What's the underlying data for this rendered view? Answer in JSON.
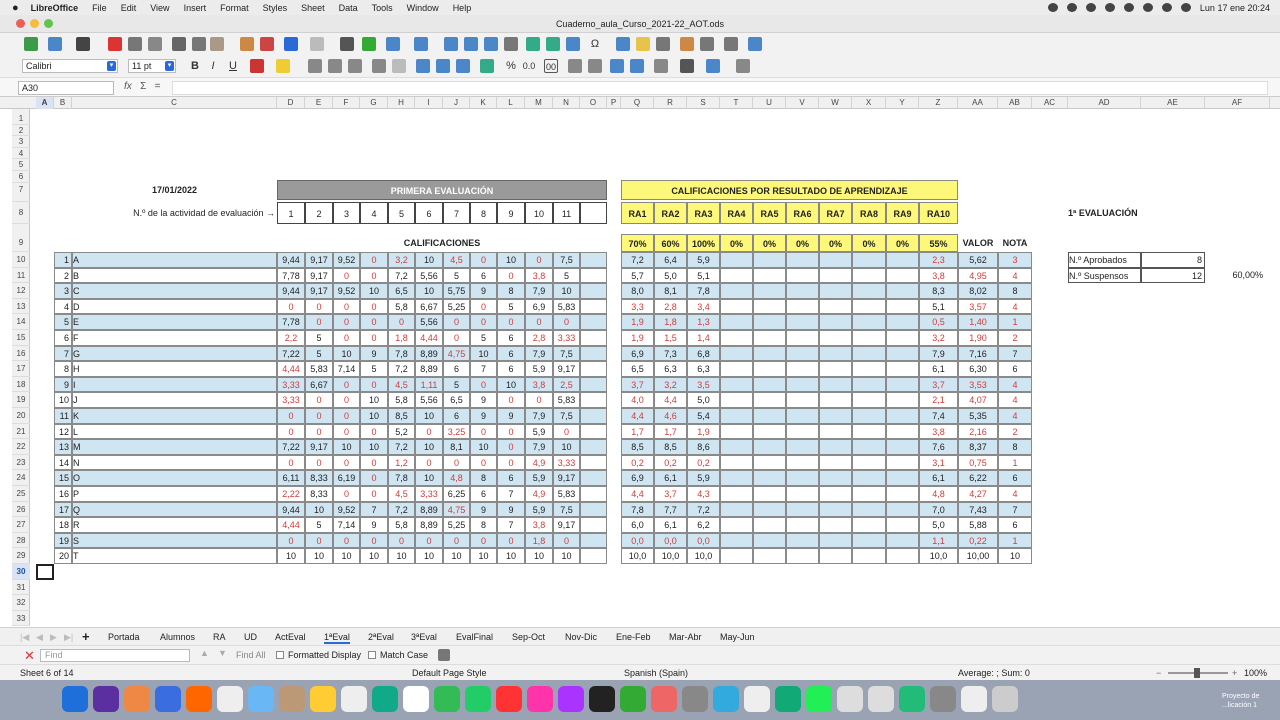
{
  "menubar": {
    "apple": "",
    "app": "LibreOffice",
    "items": [
      "File",
      "Edit",
      "View",
      "Insert",
      "Format",
      "Styles",
      "Sheet",
      "Data",
      "Tools",
      "Window",
      "Help"
    ],
    "clock": "Lun 17 ene  20:24"
  },
  "window": {
    "title": "Cuaderno_aula_Curso_2021-22_AOT.ods"
  },
  "toolbar": {
    "font_name": "Calibri",
    "font_size": "11 pt",
    "bold": "B",
    "italic": "I",
    "underline": "U",
    "percent": "%",
    "decimal": "0.0",
    "dec_places": "00"
  },
  "formula": {
    "cell_ref": "A30",
    "fx": "fx",
    "sigma": "Σ",
    "equals": "=",
    "content": ""
  },
  "columns": [
    "A",
    "B",
    "C",
    "D",
    "E",
    "F",
    "G",
    "H",
    "I",
    "J",
    "K",
    "L",
    "M",
    "N",
    "O",
    "P",
    "Q",
    "R",
    "S",
    "T",
    "U",
    "V",
    "W",
    "X",
    "Y",
    "Z",
    "AA",
    "AB",
    "AC",
    "AD",
    "AE",
    "AF"
  ],
  "rows": [
    "1",
    "2",
    "3",
    "4",
    "5",
    "6",
    "7",
    "8",
    "9",
    "10",
    "11",
    "12",
    "13",
    "14",
    "15",
    "16",
    "17",
    "18",
    "19",
    "20",
    "21",
    "22",
    "23",
    "24",
    "25",
    "26",
    "27",
    "28",
    "29",
    "30",
    "31",
    "32",
    "33"
  ],
  "sheet": {
    "date": "17/01/2022",
    "primera": "PRIMERA EVALUACIÓN",
    "activity_label": "N.º de la actividad de evaluación →",
    "activities": [
      "1",
      "2",
      "3",
      "4",
      "5",
      "6",
      "7",
      "8",
      "9",
      "10",
      "11"
    ],
    "calificaciones": "CALIFICACIONES",
    "ra_title": "CALIFICACIONES POR RESULTADO DE APRENDIZAJE",
    "ra_labels": [
      "RA1",
      "RA2",
      "RA3",
      "RA4",
      "RA5",
      "RA6",
      "RA7",
      "RA8",
      "RA9",
      "RA10"
    ],
    "ra_weights": [
      "70%",
      "60%",
      "100%",
      "0%",
      "0%",
      "0%",
      "0%",
      "0%",
      "0%",
      "55%"
    ],
    "valor": "VALOR",
    "nota": "NOTA",
    "eval_title": "1ª EVALUACIÓN",
    "aprobados_label": "N.º Aprobados",
    "aprobados": "8",
    "suspensos_label": "N.º Suspensos",
    "suspensos": "12",
    "suspensos_pct": "60,00%",
    "students": [
      {
        "n": "1",
        "name": "A",
        "acts": [
          "9,44",
          "9,17",
          "9,52",
          "0",
          "3,2",
          "10",
          "4,5",
          "0",
          "10",
          "0",
          "7,5"
        ],
        "ra": [
          "7,2",
          "6,4",
          "5,9"
        ],
        "ra10": "2,3",
        "valor": "5,62",
        "nota": "3"
      },
      {
        "n": "2",
        "name": "B",
        "acts": [
          "7,78",
          "9,17",
          "0",
          "0",
          "7,2",
          "5,56",
          "5",
          "6",
          "0",
          "3,8",
          "5"
        ],
        "ra": [
          "5,7",
          "5,0",
          "5,1"
        ],
        "ra10": "3,8",
        "valor": "4,95",
        "nota": "4"
      },
      {
        "n": "3",
        "name": "C",
        "acts": [
          "9,44",
          "9,17",
          "9,52",
          "10",
          "6,5",
          "10",
          "5,75",
          "9",
          "8",
          "7,9",
          "10"
        ],
        "ra": [
          "8,0",
          "8,1",
          "7,8"
        ],
        "ra10": "8,3",
        "valor": "8,02",
        "nota": "8"
      },
      {
        "n": "4",
        "name": "D",
        "acts": [
          "0",
          "0",
          "0",
          "0",
          "5,8",
          "6,67",
          "5,25",
          "0",
          "5",
          "6,9",
          "5,83"
        ],
        "ra": [
          "3,3",
          "2,8",
          "3,4"
        ],
        "ra10": "5,1",
        "valor": "3,57",
        "nota": "4"
      },
      {
        "n": "5",
        "name": "E",
        "acts": [
          "7,78",
          "0",
          "0",
          "0",
          "0",
          "5,56",
          "0",
          "0",
          "0",
          "0",
          "0"
        ],
        "ra": [
          "1,9",
          "1,8",
          "1,3"
        ],
        "ra10": "0,5",
        "valor": "1,40",
        "nota": "1"
      },
      {
        "n": "6",
        "name": "F",
        "acts": [
          "2,2",
          "5",
          "0",
          "0",
          "1,8",
          "4,44",
          "0",
          "5",
          "6",
          "2,8",
          "3,33"
        ],
        "ra": [
          "1,9",
          "1,5",
          "1,4"
        ],
        "ra10": "3,2",
        "valor": "1,90",
        "nota": "2"
      },
      {
        "n": "7",
        "name": "G",
        "acts": [
          "7,22",
          "5",
          "10",
          "9",
          "7,8",
          "8,89",
          "4,75",
          "10",
          "6",
          "7,9",
          "7,5"
        ],
        "ra": [
          "6,9",
          "7,3",
          "6,8"
        ],
        "ra10": "7,9",
        "valor": "7,16",
        "nota": "7"
      },
      {
        "n": "8",
        "name": "H",
        "acts": [
          "4,44",
          "5,83",
          "7,14",
          "5",
          "7,2",
          "8,89",
          "6",
          "7",
          "6",
          "5,9",
          "9,17"
        ],
        "ra": [
          "6,5",
          "6,3",
          "6,3"
        ],
        "ra10": "6,1",
        "valor": "6,30",
        "nota": "6"
      },
      {
        "n": "9",
        "name": "I",
        "acts": [
          "3,33",
          "6,67",
          "0",
          "0",
          "4,5",
          "1,11",
          "5",
          "0",
          "10",
          "3,8",
          "2,5"
        ],
        "ra": [
          "3,7",
          "3,2",
          "3,5"
        ],
        "ra10": "3,7",
        "valor": "3,53",
        "nota": "4"
      },
      {
        "n": "10",
        "name": "J",
        "acts": [
          "3,33",
          "0",
          "0",
          "10",
          "5,8",
          "5,56",
          "6,5",
          "9",
          "0",
          "0",
          "5,83"
        ],
        "ra": [
          "4,0",
          "4,4",
          "5,0"
        ],
        "ra10": "2,1",
        "valor": "4,07",
        "nota": "4"
      },
      {
        "n": "11",
        "name": "K",
        "acts": [
          "0",
          "0",
          "0",
          "10",
          "8,5",
          "10",
          "6",
          "9",
          "9",
          "7,9",
          "7,5"
        ],
        "ra": [
          "4,4",
          "4,6",
          "5,4"
        ],
        "ra10": "7,4",
        "valor": "5,35",
        "nota": "4"
      },
      {
        "n": "12",
        "name": "L",
        "acts": [
          "0",
          "0",
          "0",
          "0",
          "5,2",
          "0",
          "3,25",
          "0",
          "0",
          "5,9",
          "0"
        ],
        "ra": [
          "1,7",
          "1,7",
          "1,9"
        ],
        "ra10": "3,8",
        "valor": "2,16",
        "nota": "2"
      },
      {
        "n": "13",
        "name": "M",
        "acts": [
          "7,22",
          "9,17",
          "10",
          "10",
          "7,2",
          "10",
          "8,1",
          "10",
          "0",
          "7,9",
          "10"
        ],
        "ra": [
          "8,5",
          "8,5",
          "8,6"
        ],
        "ra10": "7,6",
        "valor": "8,37",
        "nota": "8"
      },
      {
        "n": "14",
        "name": "N",
        "acts": [
          "0",
          "0",
          "0",
          "0",
          "1,2",
          "0",
          "0",
          "0",
          "0",
          "4,9",
          "3,33"
        ],
        "ra": [
          "0,2",
          "0,2",
          "0,2"
        ],
        "ra10": "3,1",
        "valor": "0,75",
        "nota": "1"
      },
      {
        "n": "15",
        "name": "O",
        "acts": [
          "6,11",
          "8,33",
          "6,19",
          "0",
          "7,8",
          "10",
          "4,8",
          "8",
          "6",
          "5,9",
          "9,17"
        ],
        "ra": [
          "6,9",
          "6,1",
          "5,9"
        ],
        "ra10": "6,1",
        "valor": "6,22",
        "nota": "6"
      },
      {
        "n": "16",
        "name": "P",
        "acts": [
          "2,22",
          "8,33",
          "0",
          "0",
          "4,5",
          "3,33",
          "6,25",
          "6",
          "7",
          "4,9",
          "5,83"
        ],
        "ra": [
          "4,4",
          "3,7",
          "4,3"
        ],
        "ra10": "4,8",
        "valor": "4,27",
        "nota": "4"
      },
      {
        "n": "17",
        "name": "Q",
        "acts": [
          "9,44",
          "10",
          "9,52",
          "7",
          "7,2",
          "8,89",
          "4,75",
          "9",
          "9",
          "5,9",
          "7,5"
        ],
        "ra": [
          "7,8",
          "7,7",
          "7,2"
        ],
        "ra10": "7,0",
        "valor": "7,43",
        "nota": "7"
      },
      {
        "n": "18",
        "name": "R",
        "acts": [
          "4,44",
          "5",
          "7,14",
          "9",
          "5,8",
          "8,89",
          "5,25",
          "8",
          "7",
          "3,8",
          "9,17"
        ],
        "ra": [
          "6,0",
          "6,1",
          "6,2"
        ],
        "ra10": "5,0",
        "valor": "5,88",
        "nota": "6"
      },
      {
        "n": "19",
        "name": "S",
        "acts": [
          "0",
          "0",
          "0",
          "0",
          "0",
          "0",
          "0",
          "0",
          "0",
          "1,8",
          "0"
        ],
        "ra": [
          "0,0",
          "0,0",
          "0,0"
        ],
        "ra10": "1,1",
        "valor": "0,22",
        "nota": "1"
      },
      {
        "n": "20",
        "name": "T",
        "acts": [
          "10",
          "10",
          "10",
          "10",
          "10",
          "10",
          "10",
          "10",
          "10",
          "10",
          "10"
        ],
        "ra": [
          "10,0",
          "10,0",
          "10,0"
        ],
        "ra10": "10,0",
        "valor": "10,00",
        "nota": "10"
      }
    ]
  },
  "tabs": [
    "Portada",
    "Alumnos",
    "RA",
    "UD",
    "ActEval",
    "1ªEval",
    "2ªEval",
    "3ªEval",
    "EvalFinal",
    "Sep-Oct",
    "Nov-Dic",
    "Ene-Feb",
    "Mar-Abr",
    "May-Jun"
  ],
  "active_tab": "1ªEval",
  "find": {
    "placeholder": "Find",
    "find_all": "Find All",
    "formatted": "Formatted Display",
    "match_case": "Match Case"
  },
  "status": {
    "sheet": "Sheet 6 of 14",
    "style": "Default Page Style",
    "lang": "Spanish (Spain)",
    "summary": "Average: ; Sum: 0",
    "zoom": "100%"
  },
  "dock_label": "Proyecto de ...licación 1"
}
